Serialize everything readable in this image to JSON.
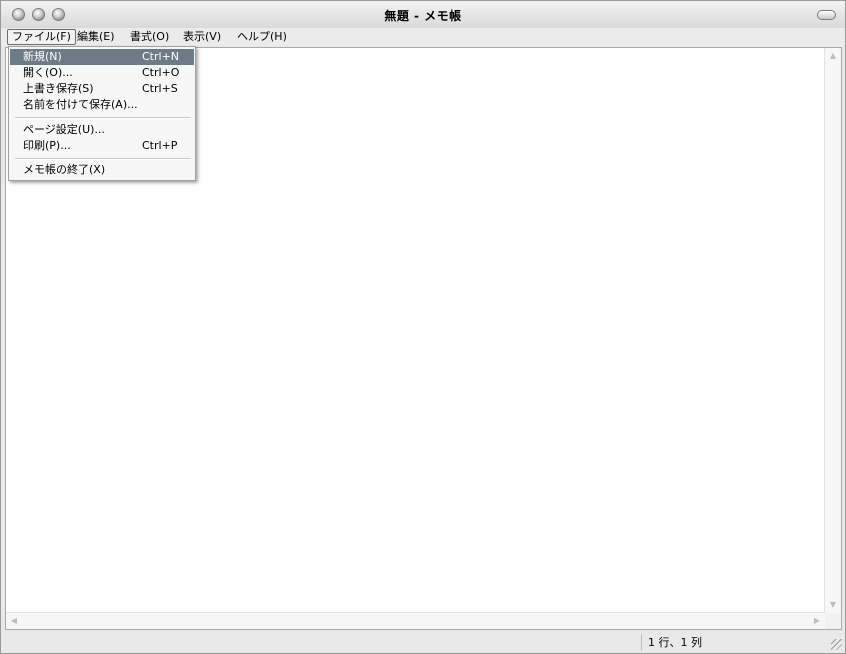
{
  "window": {
    "title": "無題 - メモ帳"
  },
  "menubar": {
    "items": [
      {
        "label": "ファイル(F)"
      },
      {
        "label": "編集(E)"
      },
      {
        "label": "書式(O)"
      },
      {
        "label": "表示(V)"
      },
      {
        "label": "ヘルプ(H)"
      }
    ]
  },
  "file_menu": {
    "items": [
      {
        "label": "新規(N)",
        "shortcut": "Ctrl+N",
        "highlighted": true
      },
      {
        "label": "開く(O)...",
        "shortcut": "Ctrl+O"
      },
      {
        "label": "上書き保存(S)",
        "shortcut": "Ctrl+S"
      },
      {
        "label": "名前を付けて保存(A)...",
        "shortcut": ""
      },
      {
        "label": "ページ設定(U)...",
        "shortcut": ""
      },
      {
        "label": "印刷(P)...",
        "shortcut": "Ctrl+P"
      },
      {
        "label": "メモ帳の終了(X)",
        "shortcut": ""
      }
    ]
  },
  "editor": {
    "content": ""
  },
  "statusbar": {
    "position": "1 行、1 列"
  },
  "colors": {
    "highlight": "#6f7a87",
    "background": "#e9e9e9"
  }
}
